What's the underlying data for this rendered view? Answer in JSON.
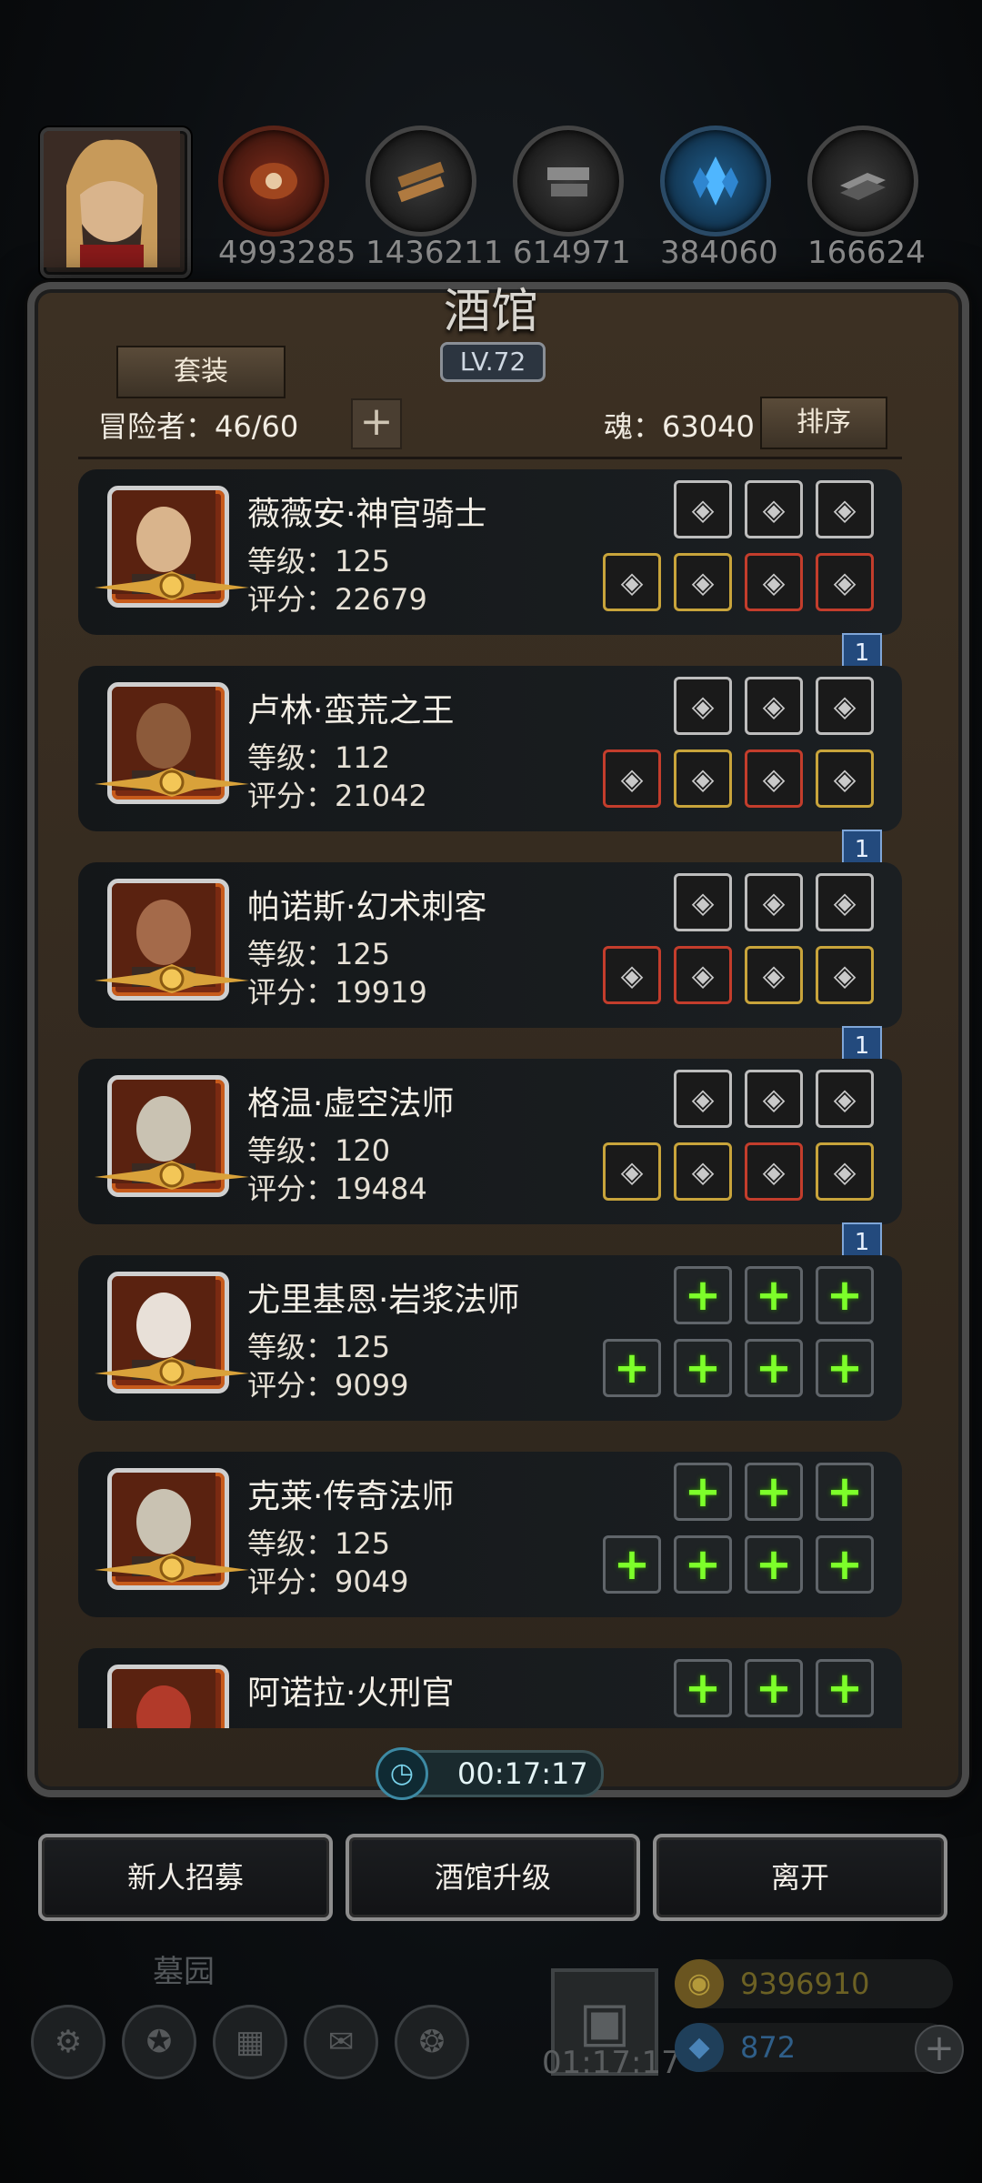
{
  "top_bar": {
    "resources": [
      {
        "icon": "meat-icon",
        "value": "4993285"
      },
      {
        "icon": "wood-icon",
        "value": "1436211"
      },
      {
        "icon": "stone-icon",
        "value": "614971"
      },
      {
        "icon": "crystal-icon",
        "value": "384060"
      },
      {
        "icon": "iron-icon",
        "value": "166624"
      }
    ]
  },
  "panel": {
    "title": "酒馆",
    "level": "LV.72",
    "set_button": "套装",
    "adventurers": "冒险者：46/60",
    "add_button": "+",
    "soul": "魂：63040",
    "sort_button": "排序"
  },
  "heroes": [
    {
      "name": "薇薇安·神官骑士",
      "level": "等级：125",
      "score": "评分：22679",
      "flag": "1",
      "top_slots": [
        {
          "icon": "heart-amulet-icon",
          "tier": "silver"
        },
        {
          "icon": "wing-icon",
          "tier": "silver"
        },
        {
          "icon": "purple-gem-icon",
          "tier": "silver"
        }
      ],
      "bottom_slots": [
        {
          "icon": "staff-icon",
          "tier": "gold"
        },
        {
          "icon": "armor-icon",
          "tier": "gold"
        },
        {
          "icon": "potion-icon",
          "tier": "red"
        },
        {
          "icon": "necklace-icon",
          "tier": "red"
        }
      ]
    },
    {
      "name": "卢林·蛮荒之王",
      "level": "等级：112",
      "score": "评分：21042",
      "flag": "1",
      "top_slots": [
        {
          "icon": "fire-icon",
          "tier": "silver"
        },
        {
          "icon": "mask-icon",
          "tier": "silver"
        },
        {
          "icon": "mask-icon",
          "tier": "silver"
        }
      ],
      "bottom_slots": [
        {
          "icon": "axe-icon",
          "tier": "red"
        },
        {
          "icon": "armor-icon",
          "tier": "gold"
        },
        {
          "icon": "potion-icon",
          "tier": "red"
        },
        {
          "icon": "necklace-icon",
          "tier": "gold"
        }
      ]
    },
    {
      "name": "帕诺斯·幻术刺客",
      "level": "等级：125",
      "score": "评分：19919",
      "flag": "1",
      "top_slots": [
        {
          "icon": "blue-orb-icon",
          "tier": "silver"
        },
        {
          "icon": "blade-icon",
          "tier": "silver"
        },
        {
          "icon": "blade-icon",
          "tier": "silver"
        }
      ],
      "bottom_slots": [
        {
          "icon": "sword-icon",
          "tier": "red"
        },
        {
          "icon": "armor-icon",
          "tier": "red"
        },
        {
          "icon": "potion-icon",
          "tier": "gold"
        },
        {
          "icon": "ring-icon",
          "tier": "gold"
        }
      ]
    },
    {
      "name": "格温·虚空法师",
      "level": "等级：120",
      "score": "评分：19484",
      "flag": "1",
      "top_slots": [
        {
          "icon": "green-crystal-icon",
          "tier": "silver"
        },
        {
          "icon": "mask-icon",
          "tier": "silver"
        },
        {
          "icon": "mask-icon",
          "tier": "silver"
        }
      ],
      "bottom_slots": [
        {
          "icon": "staff-icon",
          "tier": "gold"
        },
        {
          "icon": "armor-icon",
          "tier": "gold"
        },
        {
          "icon": "potion-icon",
          "tier": "red"
        },
        {
          "icon": "necklace-icon",
          "tier": "gold"
        }
      ]
    },
    {
      "name": "尤里基恩·岩浆法师",
      "level": "等级：125",
      "score": "评分：9099",
      "flag": "",
      "top_slots": [
        {
          "icon": "add-icon",
          "tier": "empty"
        },
        {
          "icon": "add-icon",
          "tier": "empty"
        },
        {
          "icon": "add-icon",
          "tier": "empty"
        }
      ],
      "bottom_slots": [
        {
          "icon": "add-icon",
          "tier": "empty"
        },
        {
          "icon": "add-icon",
          "tier": "empty"
        },
        {
          "icon": "add-icon",
          "tier": "empty"
        },
        {
          "icon": "add-icon",
          "tier": "empty"
        }
      ]
    },
    {
      "name": "克莱·传奇法师",
      "level": "等级：125",
      "score": "评分：9049",
      "flag": "",
      "top_slots": [
        {
          "icon": "add-icon",
          "tier": "empty"
        },
        {
          "icon": "add-icon",
          "tier": "empty"
        },
        {
          "icon": "add-icon",
          "tier": "empty"
        }
      ],
      "bottom_slots": [
        {
          "icon": "add-icon",
          "tier": "empty"
        },
        {
          "icon": "add-icon",
          "tier": "empty"
        },
        {
          "icon": "add-icon",
          "tier": "empty"
        },
        {
          "icon": "add-icon",
          "tier": "empty"
        }
      ]
    },
    {
      "name": "阿诺拉·火刑官",
      "level": "",
      "score": "",
      "flag": "",
      "top_slots": [
        {
          "icon": "add-icon",
          "tier": "empty"
        },
        {
          "icon": "add-icon",
          "tier": "empty"
        },
        {
          "icon": "add-icon",
          "tier": "empty"
        }
      ],
      "bottom_slots": []
    }
  ],
  "timer": {
    "value": "00:17:17"
  },
  "buttons": {
    "recruit": "新人招募",
    "upgrade": "酒馆升级",
    "leave": "离开"
  },
  "background": {
    "graveyard": "墓园",
    "gift_timer": "01:17:17",
    "gold": "9396910",
    "gems": "872"
  },
  "colors": {
    "accent_green": "#7dff2a",
    "flag_blue": "#234a7d",
    "tier_gold": "#c8a43b",
    "tier_red": "#c33d2c"
  }
}
